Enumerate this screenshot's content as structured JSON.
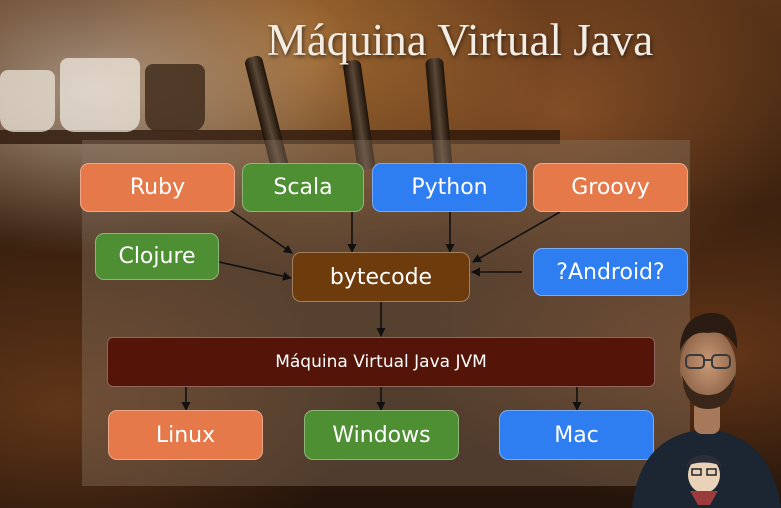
{
  "slide": {
    "title": "Máquina Virtual Java"
  },
  "languages": {
    "ruby": "Ruby",
    "scala": "Scala",
    "python": "Python",
    "groovy": "Groovy",
    "clojure": "Clojure",
    "android": "?Android?"
  },
  "core": {
    "bytecode": "bytecode",
    "jvm": "Máquina Virtual Java  JVM"
  },
  "platforms": {
    "linux": "Linux",
    "windows": "Windows",
    "mac": "Mac"
  },
  "colors": {
    "language_orange": "#e5794a",
    "language_green": "#4f8f33",
    "language_blue": "#2e7ef2",
    "bytecode_brown": "#6e3c0c",
    "jvm_dark_red": "#541408"
  },
  "icons": {
    "presenter": "presenter-webcam-overlay"
  }
}
